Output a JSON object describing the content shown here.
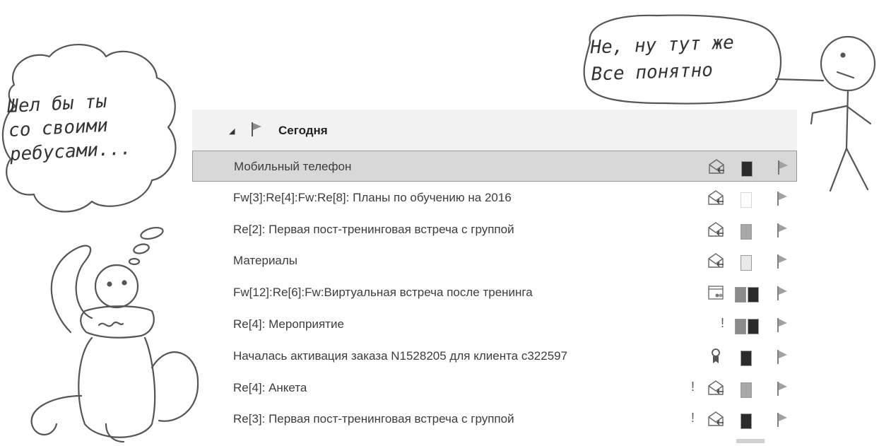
{
  "cartoon": {
    "left_bubble_lines": [
      "Шел бы ты",
      "со своими",
      "ребусами..."
    ],
    "right_bubble_lines": [
      "Не, ну тут же",
      "Все понятно"
    ]
  },
  "mail_list": {
    "group": {
      "label": "Сегодня",
      "icon": "flag-icon",
      "toggle": "collapse-triangle-icon"
    },
    "rows": [
      {
        "subject": "Мобильный телефон",
        "selected": true,
        "icon": "envelope-reply-icon",
        "important": false,
        "categories": [
          "#2b2b2b"
        ]
      },
      {
        "subject": "Fw[3]:Re[4]:Fw:Re[8]: Планы по обучению на 2016",
        "selected": false,
        "icon": "envelope-reply-icon",
        "important": false,
        "categories": [
          "#ffffff"
        ]
      },
      {
        "subject": "Re[2]: Первая пост-тренинговая встреча с группой",
        "selected": false,
        "icon": "envelope-reply-icon",
        "important": false,
        "categories": [
          "#a8a8a8"
        ]
      },
      {
        "subject": "Материалы",
        "selected": false,
        "icon": "envelope-reply-icon",
        "important": false,
        "categories": [
          "#e8e8e8"
        ]
      },
      {
        "subject": "Fw[12]:Re[6]:Fw:Виртуальная встреча после тренинга",
        "selected": false,
        "icon": "meeting-calendar-icon",
        "important": false,
        "categories": [
          "#8a8a8a",
          "#2b2b2b"
        ]
      },
      {
        "subject": "Re[4]: Мероприятие",
        "selected": false,
        "icon": "",
        "important": true,
        "categories": [
          "#8a8a8a",
          "#2b2b2b"
        ]
      },
      {
        "subject": "Началась активация заказа N1528205 для клиента c322597",
        "selected": false,
        "icon": "ribbon-award-icon",
        "important": false,
        "categories": [
          "#2b2b2b"
        ]
      },
      {
        "subject": "Re[4]: Анкета",
        "selected": false,
        "icon": "envelope-reply-icon",
        "important": true,
        "categories": [
          "#a8a8a8"
        ]
      },
      {
        "subject": "Re[3]: Первая пост-тренинговая встреча с группой",
        "selected": false,
        "icon": "envelope-reply-icon",
        "important": true,
        "categories": [
          "#2b2b2b"
        ]
      }
    ],
    "important_mark": "!"
  }
}
